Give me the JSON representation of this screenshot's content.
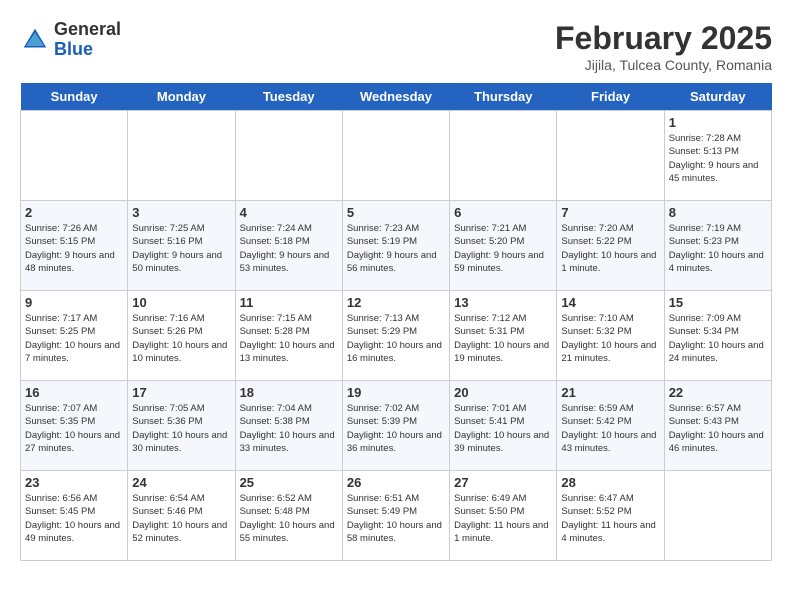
{
  "app": {
    "logo_general": "General",
    "logo_blue": "Blue"
  },
  "calendar": {
    "month": "February 2025",
    "location": "Jijila, Tulcea County, Romania",
    "days_of_week": [
      "Sunday",
      "Monday",
      "Tuesday",
      "Wednesday",
      "Thursday",
      "Friday",
      "Saturday"
    ],
    "weeks": [
      [
        {
          "day": null
        },
        {
          "day": null
        },
        {
          "day": null
        },
        {
          "day": null
        },
        {
          "day": null
        },
        {
          "day": null
        },
        {
          "day": 1,
          "sunrise": "7:28 AM",
          "sunset": "5:13 PM",
          "daylight": "9 hours and 45 minutes."
        }
      ],
      [
        {
          "day": 2,
          "sunrise": "7:26 AM",
          "sunset": "5:15 PM",
          "daylight": "9 hours and 48 minutes."
        },
        {
          "day": 3,
          "sunrise": "7:25 AM",
          "sunset": "5:16 PM",
          "daylight": "9 hours and 50 minutes."
        },
        {
          "day": 4,
          "sunrise": "7:24 AM",
          "sunset": "5:18 PM",
          "daylight": "9 hours and 53 minutes."
        },
        {
          "day": 5,
          "sunrise": "7:23 AM",
          "sunset": "5:19 PM",
          "daylight": "9 hours and 56 minutes."
        },
        {
          "day": 6,
          "sunrise": "7:21 AM",
          "sunset": "5:20 PM",
          "daylight": "9 hours and 59 minutes."
        },
        {
          "day": 7,
          "sunrise": "7:20 AM",
          "sunset": "5:22 PM",
          "daylight": "10 hours and 1 minute."
        },
        {
          "day": 8,
          "sunrise": "7:19 AM",
          "sunset": "5:23 PM",
          "daylight": "10 hours and 4 minutes."
        }
      ],
      [
        {
          "day": 9,
          "sunrise": "7:17 AM",
          "sunset": "5:25 PM",
          "daylight": "10 hours and 7 minutes."
        },
        {
          "day": 10,
          "sunrise": "7:16 AM",
          "sunset": "5:26 PM",
          "daylight": "10 hours and 10 minutes."
        },
        {
          "day": 11,
          "sunrise": "7:15 AM",
          "sunset": "5:28 PM",
          "daylight": "10 hours and 13 minutes."
        },
        {
          "day": 12,
          "sunrise": "7:13 AM",
          "sunset": "5:29 PM",
          "daylight": "10 hours and 16 minutes."
        },
        {
          "day": 13,
          "sunrise": "7:12 AM",
          "sunset": "5:31 PM",
          "daylight": "10 hours and 19 minutes."
        },
        {
          "day": 14,
          "sunrise": "7:10 AM",
          "sunset": "5:32 PM",
          "daylight": "10 hours and 21 minutes."
        },
        {
          "day": 15,
          "sunrise": "7:09 AM",
          "sunset": "5:34 PM",
          "daylight": "10 hours and 24 minutes."
        }
      ],
      [
        {
          "day": 16,
          "sunrise": "7:07 AM",
          "sunset": "5:35 PM",
          "daylight": "10 hours and 27 minutes."
        },
        {
          "day": 17,
          "sunrise": "7:05 AM",
          "sunset": "5:36 PM",
          "daylight": "10 hours and 30 minutes."
        },
        {
          "day": 18,
          "sunrise": "7:04 AM",
          "sunset": "5:38 PM",
          "daylight": "10 hours and 33 minutes."
        },
        {
          "day": 19,
          "sunrise": "7:02 AM",
          "sunset": "5:39 PM",
          "daylight": "10 hours and 36 minutes."
        },
        {
          "day": 20,
          "sunrise": "7:01 AM",
          "sunset": "5:41 PM",
          "daylight": "10 hours and 39 minutes."
        },
        {
          "day": 21,
          "sunrise": "6:59 AM",
          "sunset": "5:42 PM",
          "daylight": "10 hours and 43 minutes."
        },
        {
          "day": 22,
          "sunrise": "6:57 AM",
          "sunset": "5:43 PM",
          "daylight": "10 hours and 46 minutes."
        }
      ],
      [
        {
          "day": 23,
          "sunrise": "6:56 AM",
          "sunset": "5:45 PM",
          "daylight": "10 hours and 49 minutes."
        },
        {
          "day": 24,
          "sunrise": "6:54 AM",
          "sunset": "5:46 PM",
          "daylight": "10 hours and 52 minutes."
        },
        {
          "day": 25,
          "sunrise": "6:52 AM",
          "sunset": "5:48 PM",
          "daylight": "10 hours and 55 minutes."
        },
        {
          "day": 26,
          "sunrise": "6:51 AM",
          "sunset": "5:49 PM",
          "daylight": "10 hours and 58 minutes."
        },
        {
          "day": 27,
          "sunrise": "6:49 AM",
          "sunset": "5:50 PM",
          "daylight": "11 hours and 1 minute."
        },
        {
          "day": 28,
          "sunrise": "6:47 AM",
          "sunset": "5:52 PM",
          "daylight": "11 hours and 4 minutes."
        },
        {
          "day": null
        }
      ]
    ]
  }
}
